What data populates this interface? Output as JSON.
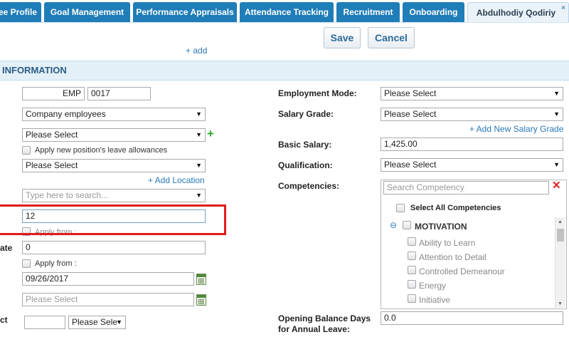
{
  "tabs": [
    {
      "label": "ee Profile"
    },
    {
      "label": "Goal Management"
    },
    {
      "label": "Performance Appraisals"
    },
    {
      "label": "Attendance Tracking"
    },
    {
      "label": "Recruitment"
    },
    {
      "label": "Onboarding"
    },
    {
      "label": "Abdulhodiy Qodiriy",
      "close": "×"
    }
  ],
  "toolbar": {
    "save_label": "Save",
    "cancel_label": "Cancel",
    "add_link": "+ add"
  },
  "section": {
    "title": "INFORMATION"
  },
  "left": {
    "emp_prefix": "EMP",
    "emp_number": "0017",
    "employee_type": "Company employees",
    "position_select": "Please Select",
    "apply_leave_label": "Apply new position's leave allowances",
    "location_select": "Please Select",
    "add_location": "+ Add Location",
    "search_placeholder": "Type here to search...",
    "value_12": "12",
    "apply_from_1": "Apply from :",
    "rate_label": "ate",
    "rate_value": "0",
    "apply_from_2": "Apply from :",
    "date_value": "09/26/2017",
    "date_placeholder": "Please Select",
    "ct_label": "ct",
    "small_select": "Please Sele"
  },
  "right": {
    "employment_mode_label": "Employment Mode:",
    "employment_mode_value": "Please Select",
    "salary_grade_label": "Salary Grade:",
    "salary_grade_value": "Please Select",
    "add_salary_grade": "+ Add New Salary Grade",
    "basic_salary_label": "Basic Salary:",
    "basic_salary_value": "1,425.00",
    "qualification_label": "Qualification:",
    "qualification_value": "Please Select",
    "competencies_label": "Competencies:",
    "competency_search_placeholder": "Search Competency",
    "select_all": "Select All Competencies",
    "group": "MOTIVATION",
    "group_toggle": "⊖",
    "items": [
      "Ability to Learn",
      "Attention to Detail",
      "Controlled Demeanour",
      "Energy",
      "Initiative"
    ],
    "opening_balance_label_1": "Opening Balance Days",
    "opening_balance_label_2": "for Annual Leave:",
    "opening_balance_value": "0.0"
  },
  "icons": {
    "close": "close-icon",
    "clear": "clear-x-icon",
    "calendar": "calendar-icon",
    "plus": "plus-icon"
  },
  "colors": {
    "tab_bg": "#1f7db8",
    "highlight": "#e21b1b",
    "link": "#2a79b9"
  }
}
